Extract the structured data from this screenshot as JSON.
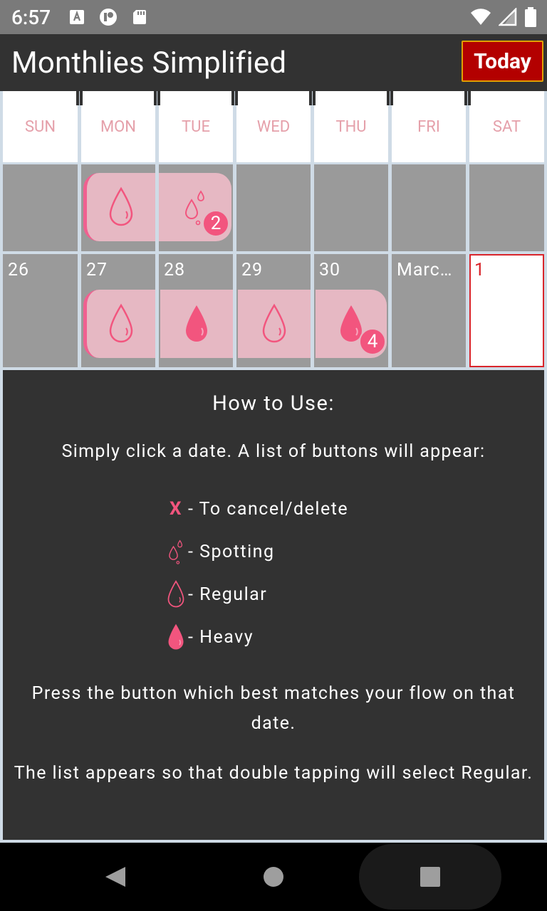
{
  "status": {
    "time": "6:57"
  },
  "app": {
    "title": "Monthlies Simplified",
    "today_label": "Today"
  },
  "calendar": {
    "days": [
      "SUN",
      "MON",
      "TUE",
      "WED",
      "THU",
      "FRI",
      "SAT"
    ],
    "week2": [
      "26",
      "27",
      "28",
      "29",
      "30",
      "Marc…",
      "1"
    ],
    "badges": {
      "tue_week1": "2",
      "thu_week2": "4"
    }
  },
  "help": {
    "title": "How to Use:",
    "intro": "Simply click a date. A list of buttons will appear:",
    "legend": [
      {
        "symbol": "X",
        "label": "- To cancel/delete"
      },
      {
        "label": "- Spotting"
      },
      {
        "label": "- Regular"
      },
      {
        "label": "- Heavy"
      }
    ],
    "para1": "Press the button which best matches your flow on that date.",
    "para2": "The list appears so that double tapping will select Regular."
  },
  "colors": {
    "accent": "#f2557e",
    "pill": "#e6b8c3",
    "today_border": "#d9252b",
    "cell": "#9a9a9a",
    "panel": "#323232"
  }
}
